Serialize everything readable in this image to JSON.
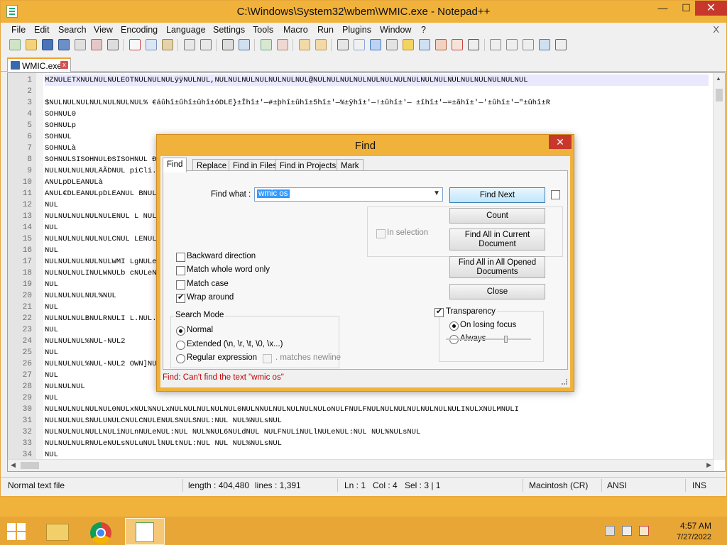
{
  "window": {
    "title": "C:\\Windows\\System32\\wbem\\WMIC.exe - Notepad++",
    "minimize": "—",
    "maximize": "☐",
    "close": "✕"
  },
  "menu": {
    "items": [
      "File",
      "Edit",
      "Search",
      "View",
      "Encoding",
      "Language",
      "Settings",
      "Tools",
      "Macro",
      "Run",
      "Plugins",
      "Window",
      "?"
    ],
    "close_x": "X"
  },
  "tab": {
    "label": "WMIC.exe",
    "close": "x"
  },
  "editor": {
    "lines": [
      {
        "n": "1",
        "text": "MZNULETXNULNULNULEOTNULNULNULÿÿNULNUL,NULNULNULNULNULNULNUL@NULNULNULNULNULNULNULNULNULNULNULNULNULNULNULNUL"
      },
      {
        "n": "2",
        "text": ""
      },
      {
        "n": "3",
        "text": "$NULNULNULNULNULNULNUL%   €áûhî±ûhî±ûhî±óDLE}±Îhî±'—#±þhî±ûhî±5hî±'—%±ÿhî±'—!±ûhî±'— ±îhî±'—=±âhî±'—'±ûhî±'—\"±ûhî±R"
      },
      {
        "n": "4",
        "text": "SOHNUL0"
      },
      {
        "n": "5",
        "text": "SOHNULp"
      },
      {
        "n": "6",
        "text": "SOHNUL"
      },
      {
        "n": "7",
        "text": "SOHNULà"
      },
      {
        "n": "8",
        "text": "SOHNULSISOHNULÐSISOHNUL                                                          ÐDC1SOHNUL0DC2SOHNUL`"
      },
      {
        "n": "9",
        "text": "NULNULNULNULÄÃDNUL                                                                      piCli.dllNULNULNULNUL"
      },
      {
        "n": "10",
        "text": "ANULpDLEANULà"
      },
      {
        "n": "11",
        "text": "ANUL€DLEANULpDLEANUL                                                                 BNUL``BNULNUL&BNULÐÇCN"
      },
      {
        "n": "12",
        "text": "NUL"
      },
      {
        "n": "13",
        "text": "NULNULNULNULNULENUL                                                                 L  NULeNULrNULrNULoNUL"
      },
      {
        "n": "14",
        "text": "NUL"
      },
      {
        "n": "15",
        "text": "NULNULNULNULNULCNUL                                                                 LENULSNULSNUL  NUL%NUL"
      },
      {
        "n": "16",
        "text": "NUL"
      },
      {
        "n": "17",
        "text": "NULNULNULNULNULWMI                                                                 LgNULeNULsNUL(NUL-NUL"
      },
      {
        "n": "18",
        "text": "NULNULNULINULWNULb                                                                 cNULeNULCNULlNULaNULsN"
      },
      {
        "n": "19",
        "text": "NUL"
      },
      {
        "n": "20",
        "text": "NULNULNULNUL%NUL"
      },
      {
        "n": "21",
        "text": "NUL"
      },
      {
        "n": "22",
        "text": "NULNULNULBNULRNULI                                                                 L.NUL.NUL"
      },
      {
        "n": "23",
        "text": "NUL"
      },
      {
        "n": "24",
        "text": "NULNULNUL%NUL-NUL2"
      },
      {
        "n": "25",
        "text": "NUL"
      },
      {
        "n": "26",
        "text": "NULNULNUL%NUL-NUL2                                                                 OWN]NULNULNUL(NULNULNU"
      },
      {
        "n": "27",
        "text": "NUL"
      },
      {
        "n": "28",
        "text": "NULNULNUL"
      },
      {
        "n": "29",
        "text": "NUL"
      },
      {
        "n": "30",
        "text": "NULNULNULNULNUL0NULxNUL%NULxNULNULNULNULNUL0NULNNULNULNULNULNULoNULFNULFNULNULNULNULNULNULNULINULXNULMNULI"
      },
      {
        "n": "31",
        "text": "NULNULNULSNULUNULCNULCNULENULSNULSNUL:NUL  NUL%NULsNUL"
      },
      {
        "n": "32",
        "text": "NULNULNULNULLNULiNULnNULeNUL:NUL  NUL%NUL6NULdNUL  NULFNULiNULlNULeNUL:NUL  NUL%NULsNUL"
      },
      {
        "n": "33",
        "text": "NULNULNULRNULeNULsNULuNULlNULtNUL:NUL  NUL  NUL%NULsNUL"
      },
      {
        "n": "34",
        "text": "NUL"
      }
    ]
  },
  "status": {
    "file_type": "Normal text file",
    "length": "length : 404,480",
    "lines": "lines : 1,391",
    "ln": "Ln : 1",
    "col": "Col : 4",
    "sel": "Sel : 3 | 1",
    "eol": "Macintosh (CR)",
    "encoding": "ANSI",
    "ins": "INS"
  },
  "find_dialog": {
    "title": "Find",
    "close": "✕",
    "tabs": [
      "Find",
      "Replace",
      "Find in Files",
      "Find in Projects",
      "Mark"
    ],
    "find_what_label": "Find what :",
    "find_what_value": "wmic os",
    "buttons": {
      "find_next": "Find Next",
      "count": "Count",
      "find_all_current_1": "Find All in Current",
      "find_all_current_2": "Document",
      "find_all_opened_1": "Find All in All Opened",
      "find_all_opened_2": "Documents",
      "close": "Close"
    },
    "in_selection": "In selection",
    "options": {
      "backward": "Backward direction",
      "whole_word": "Match whole word only",
      "match_case": "Match case",
      "wrap_around": "Wrap around"
    },
    "search_mode": {
      "label": "Search Mode",
      "normal": "Normal",
      "extended": "Extended (\\n, \\r, \\t, \\0, \\x...)",
      "regex": "Regular expression",
      "matches_newline": ". matches newline"
    },
    "transparency": {
      "label": "Transparency",
      "on_losing_focus": "On losing focus",
      "always": "Always",
      "level": 0.68
    },
    "status_message": "Find: Can't find the text \"wmic os\""
  },
  "taskbar": {
    "time": "4:57 AM",
    "date": "7/27/2022"
  }
}
